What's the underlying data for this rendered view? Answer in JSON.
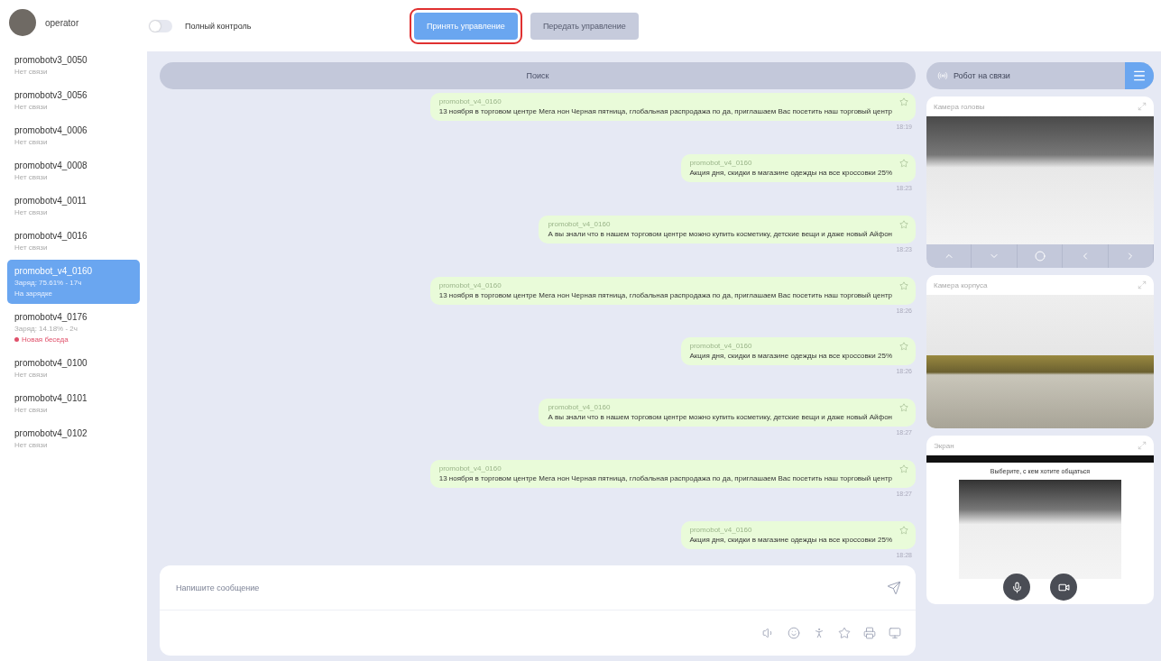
{
  "user": {
    "name": "operator"
  },
  "full_control": {
    "label": "Полный контроль",
    "on": false
  },
  "control_buttons": [
    {
      "label": "Принять управление",
      "disabled": false,
      "highlighted": true
    },
    {
      "label": "Передать управление",
      "disabled": true,
      "highlighted": false
    }
  ],
  "search": {
    "placeholder": "Поиск"
  },
  "robots": [
    {
      "name": "promobotv3_0050",
      "details": [
        "Нет связи"
      ],
      "selected": false
    },
    {
      "name": "promobotv3_0056",
      "details": [
        "Нет связи"
      ],
      "selected": false
    },
    {
      "name": "promobotv4_0006",
      "details": [
        "Нет связи"
      ],
      "selected": false
    },
    {
      "name": "promobotv4_0008",
      "details": [
        "Нет связи"
      ],
      "selected": false
    },
    {
      "name": "promobotv4_0011",
      "details": [
        "Нет связи"
      ],
      "selected": false
    },
    {
      "name": "promobotv4_0016",
      "details": [
        "Нет связи"
      ],
      "selected": false
    },
    {
      "name": "promobot_v4_0160",
      "details": [
        "Заряд: 75.61% - 17ч",
        "На зарядке"
      ],
      "selected": true
    },
    {
      "name": "promobotv4_0176",
      "details": [
        "Заряд: 14.18% - 2ч"
      ],
      "notice": {
        "text": "Новая беседа",
        "color": "#e0506a"
      },
      "selected": false
    },
    {
      "name": "promobotv4_0100",
      "details": [
        "Нет связи"
      ],
      "selected": false
    },
    {
      "name": "promobotv4_0101",
      "details": [
        "Нет связи"
      ],
      "selected": false
    },
    {
      "name": "promobotv4_0102",
      "details": [
        "Нет связи"
      ],
      "selected": false
    }
  ],
  "messages": [
    {
      "sender": "promobot_v4_0160",
      "text": "13 ноября в торговом центре Мега нон Черная пятница, глобальная распродажа по да, приглашаем Вас посетить наш торговый центр",
      "time": "18:19"
    },
    {
      "sender": "promobot_v4_0160",
      "text": "Акция дня, скидки в магазине одежды на все кроссовки 25%",
      "time": "18:23"
    },
    {
      "sender": "promobot_v4_0160",
      "text": "А вы знали что в нашем торговом центре можно купить косметику, детские вещи и даже новый Айфон",
      "time": "18:23"
    },
    {
      "sender": "promobot_v4_0160",
      "text": "13 ноября в торговом центре Мега нон Черная пятница, глобальная распродажа по да, приглашаем Вас посетить наш торговый центр",
      "time": "18:26"
    },
    {
      "sender": "promobot_v4_0160",
      "text": "Акция дня, скидки в магазине одежды на все кроссовки 25%",
      "time": "18:26"
    },
    {
      "sender": "promobot_v4_0160",
      "text": "А вы знали что в нашем торговом центре можно купить косметику, детские вещи и даже новый Айфон",
      "time": "18:27"
    },
    {
      "sender": "promobot_v4_0160",
      "text": "13 ноября в торговом центре Мега нон Черная пятница, глобальная распродажа по да, приглашаем Вас посетить наш торговый центр",
      "time": "18:27"
    },
    {
      "sender": "promobot_v4_0160",
      "text": "Акция дня, скидки в магазине одежды на все кроссовки 25%",
      "time": "18:28"
    }
  ],
  "composer": {
    "placeholder": "Напишите сообщение"
  },
  "robot_status": {
    "label": "Робот на связи"
  },
  "panels": [
    {
      "kind": "head",
      "title": "Камера головы"
    },
    {
      "kind": "body",
      "title": "Камера корпуса"
    },
    {
      "kind": "screen",
      "title": "Экран",
      "screen_text": "Выберите, с кем хотите общаться"
    }
  ]
}
